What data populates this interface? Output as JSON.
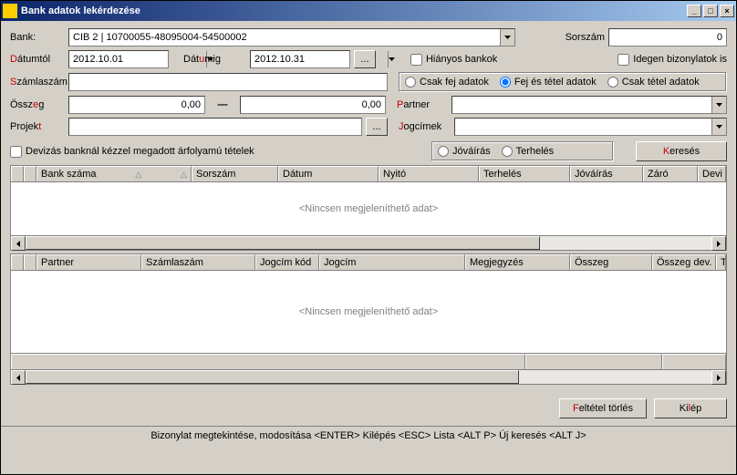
{
  "window": {
    "title": "Bank adatok lekérdezése",
    "min": "_",
    "max": "□",
    "close": "×"
  },
  "labels": {
    "bank": "Bank:",
    "sorszam": "Sorszám",
    "datumtol_d": "D",
    "datumtol_rest": "átumtól",
    "datumig_pre": "Dát",
    "datumig_u": "u",
    "datumig_rest": "mig",
    "szamlaszam_s": "S",
    "szamlaszam_rest": "zámlaszám",
    "osszeg_pre": "Össz",
    "osszeg_e": "e",
    "osszeg_rest": "g",
    "partner_p": "P",
    "partner_rest": "artner",
    "projekt_pre": "Projek",
    "projekt_t": "t",
    "jogcimek_j": "J",
    "jogcimek_rest": "ogcímek",
    "hianyos": "Hiányos bankok",
    "idegen": "Idegen bizonylatok is",
    "csak_fej": "Csak fej adatok",
    "fej_tetel": "Fej és tétel adatok",
    "csak_tetel": "Csak tétel adatok",
    "devizas": "Devizás banknál kézzel megadott árfolyamú tételek",
    "jovairas": "Jóváírás",
    "terheles": "Terhelés",
    "kereses_k": "K",
    "kereses_rest": "eresés",
    "feltetel_f": "F",
    "feltetel_rest": "eltétel törlés",
    "kilep_pre": "Ki",
    "kilep_l": "l",
    "kilep_rest": "ép",
    "dash": "—",
    "dots": "...",
    "nodata": "<Nincsen megjeleníthető adat>"
  },
  "values": {
    "bank": "CIB 2 | 10700055-48095004-54500002",
    "sorszam": "0",
    "datumtol": "2012.10.01",
    "datumig": "2012.10.31",
    "osszeg_from": "0,00",
    "osszeg_to": "0,00"
  },
  "grid1": {
    "cols": [
      "",
      "",
      "Bank száma",
      "Sorszám",
      "Dátum",
      "Nyitó",
      "Terhelés",
      "Jóváírás",
      "Záró",
      "Devi"
    ]
  },
  "grid2": {
    "cols": [
      "",
      "",
      "Partner",
      "Számlaszám",
      "Jogcím kód",
      "Jogcím",
      "Megjegyzés",
      "Összeg",
      "Összeg dev.",
      "Tip"
    ]
  },
  "status": "Bizonylat megtekintése, modosítása <ENTER>   Kilépés <ESC> Lista <ALT P> Új keresés <ALT J>"
}
